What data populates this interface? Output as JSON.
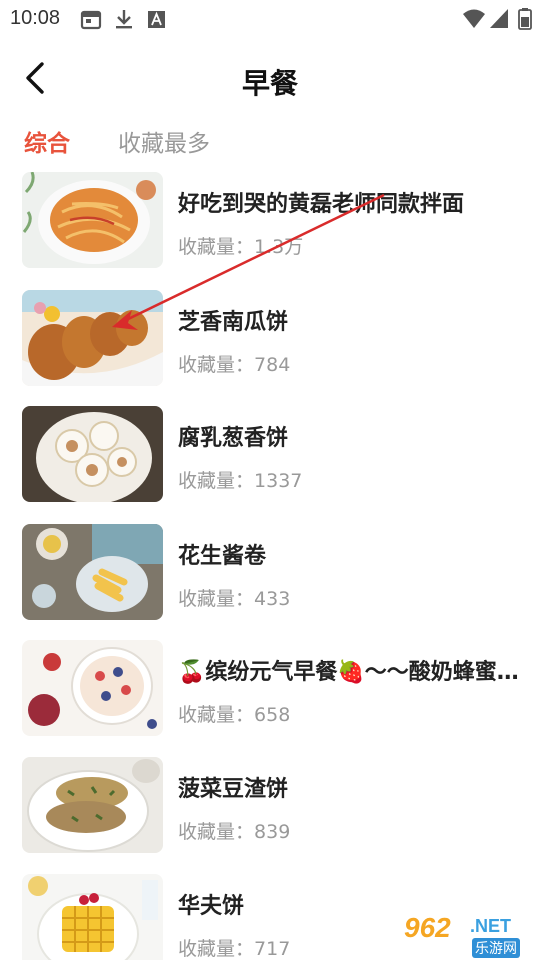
{
  "status_bar": {
    "time": "10:08",
    "icons": [
      "calendar-icon",
      "download-icon",
      "font-icon",
      "wifi-icon",
      "signal-icon",
      "battery-icon"
    ]
  },
  "header": {
    "title": "早餐",
    "back_icon": "chevron-left-icon"
  },
  "tabs": [
    {
      "label": "综合",
      "active": true
    },
    {
      "label": "收藏最多",
      "active": false
    }
  ],
  "recipes": [
    {
      "title": "好吃到哭的黄磊老师同款拌面",
      "favorites_label": "收藏量：",
      "favorites": "1.3万"
    },
    {
      "title": "芝香南瓜饼",
      "favorites_label": "收藏量：",
      "favorites": "784"
    },
    {
      "title": "腐乳葱香饼",
      "favorites_label": "收藏量：",
      "favorites": "1337"
    },
    {
      "title": "花生酱卷",
      "favorites_label": "收藏量：",
      "favorites": "433"
    },
    {
      "title": "🍒缤纷元气早餐🍓〜〜酸奶蜂蜜燕麦碗",
      "favorites_label": "收藏量：",
      "favorites": "658"
    },
    {
      "title": "菠菜豆渣饼",
      "favorites_label": "收藏量：",
      "favorites": "839"
    },
    {
      "title": "华夫饼",
      "favorites_label": "收藏量：",
      "favorites": "717"
    }
  ],
  "watermark": {
    "logo": "962",
    "domain": ".NET",
    "site": "乐游网"
  },
  "colors": {
    "accent": "#e8533c",
    "annotation_arrow": "#d92b2b",
    "muted_text": "#999999"
  }
}
